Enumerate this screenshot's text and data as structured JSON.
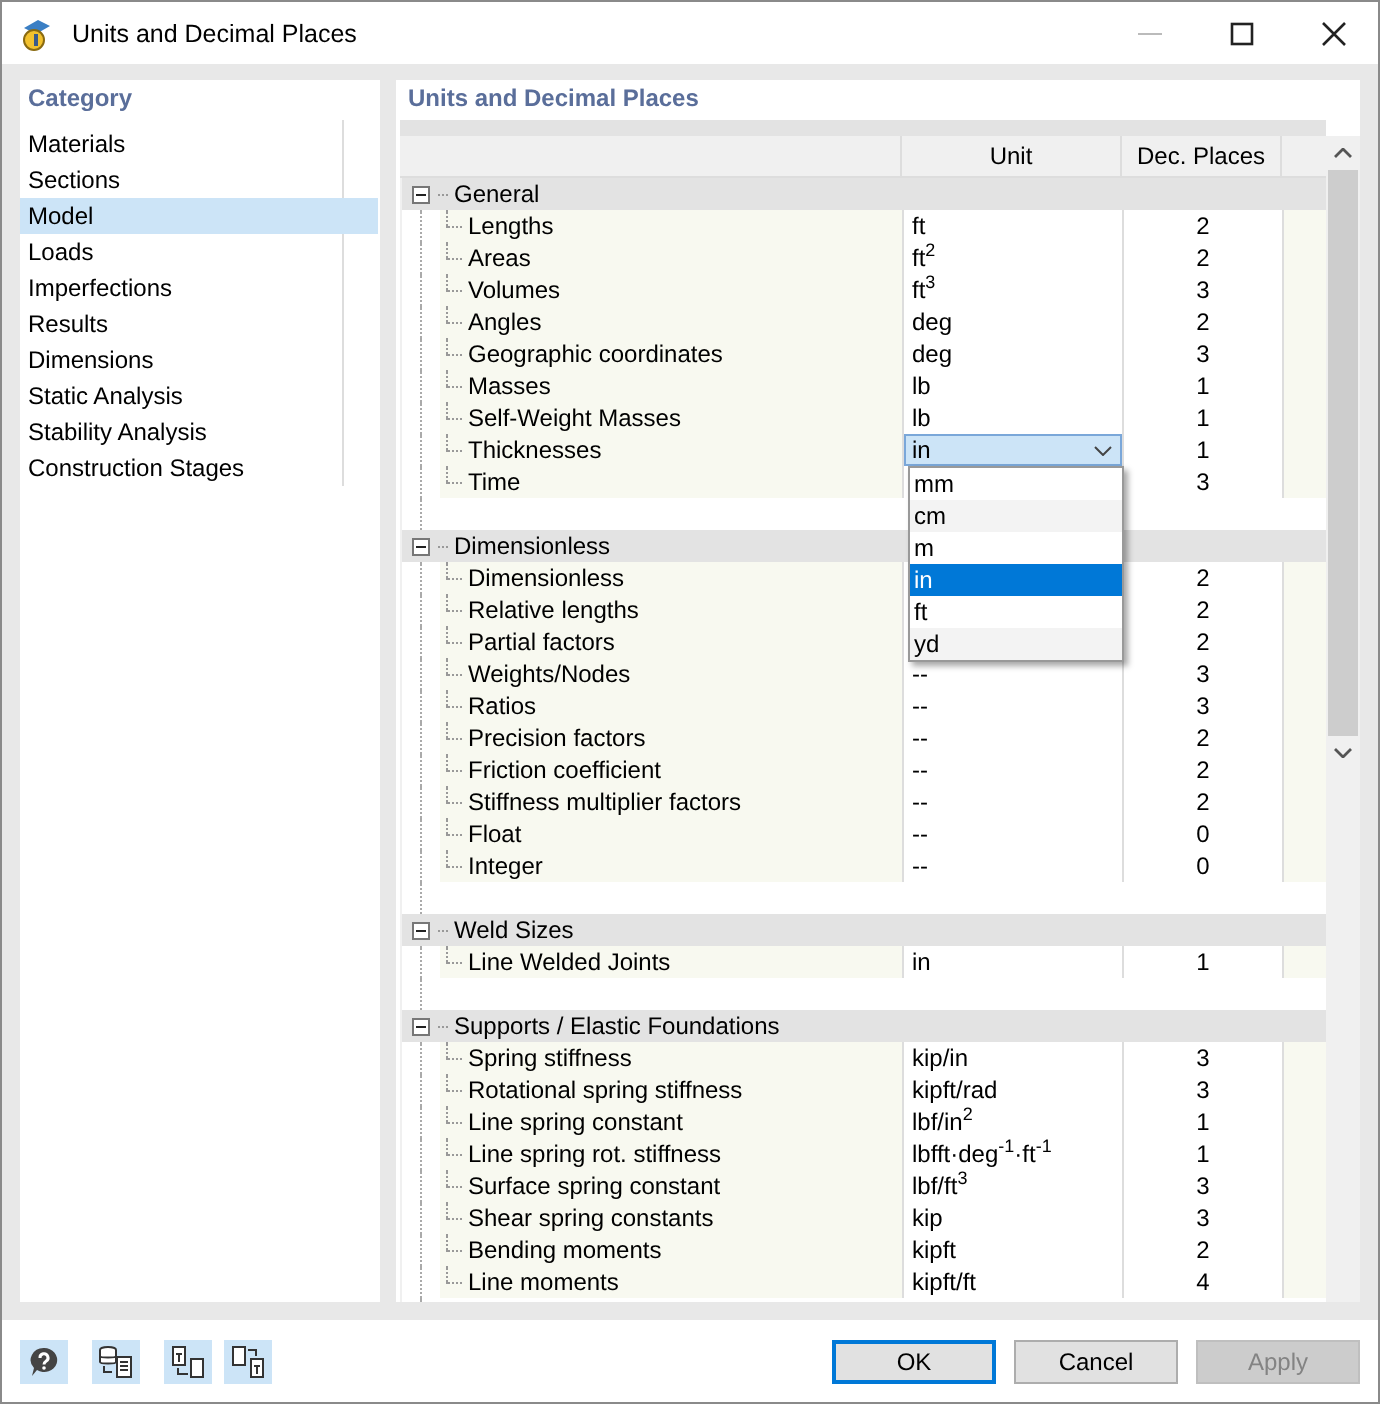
{
  "window": {
    "title": "Units and Decimal Places"
  },
  "sidebar": {
    "title": "Category",
    "items": [
      {
        "label": "Materials",
        "selected": false
      },
      {
        "label": "Sections",
        "selected": false
      },
      {
        "label": "Model",
        "selected": true
      },
      {
        "label": "Loads",
        "selected": false
      },
      {
        "label": "Imperfections",
        "selected": false
      },
      {
        "label": "Results",
        "selected": false
      },
      {
        "label": "Dimensions",
        "selected": false
      },
      {
        "label": "Static Analysis",
        "selected": false
      },
      {
        "label": "Stability Analysis",
        "selected": false
      },
      {
        "label": "Construction Stages",
        "selected": false
      }
    ]
  },
  "table": {
    "title": "Units and Decimal Places",
    "columns": [
      "Unit",
      "Dec. Places"
    ],
    "groups": [
      {
        "label": "General",
        "expanded": true,
        "rows": [
          {
            "name": "Lengths",
            "unit": "ft",
            "decimals": "2"
          },
          {
            "name": "Areas",
            "unit": "ft$^{2}$",
            "decimals": "2"
          },
          {
            "name": "Volumes",
            "unit": "ft$^{3}$",
            "decimals": "3"
          },
          {
            "name": "Angles",
            "unit": "deg",
            "decimals": "2"
          },
          {
            "name": "Geographic coordinates",
            "unit": "deg",
            "decimals": "3"
          },
          {
            "name": "Masses",
            "unit": "lb",
            "decimals": "1"
          },
          {
            "name": "Self-Weight Masses",
            "unit": "lb",
            "decimals": "1"
          },
          {
            "name": "Thicknesses",
            "unit": "in",
            "decimals": "1",
            "dropdown": {
              "options": [
                {
                  "label": "mm",
                  "selected": false
                },
                {
                  "label": "cm",
                  "selected": false
                },
                {
                  "label": "m",
                  "selected": false
                },
                {
                  "label": "in",
                  "selected": true
                },
                {
                  "label": "ft",
                  "selected": false
                },
                {
                  "label": "yd",
                  "selected": false
                }
              ]
            }
          },
          {
            "name": "Time",
            "decimals": "3"
          }
        ]
      },
      {
        "label": "Dimensionless",
        "expanded": true,
        "rows": [
          {
            "name": "Dimensionless",
            "decimals": "2"
          },
          {
            "name": "Relative lengths",
            "decimals": "2"
          },
          {
            "name": "Partial factors",
            "decimals": "2"
          },
          {
            "name": "Weights/Nodes",
            "unit": "--",
            "decimals": "3"
          },
          {
            "name": "Ratios",
            "unit": "--",
            "decimals": "3"
          },
          {
            "name": "Precision factors",
            "unit": "--",
            "decimals": "2"
          },
          {
            "name": "Friction coefficient",
            "unit": "--",
            "decimals": "2"
          },
          {
            "name": "Stiffness multiplier factors",
            "unit": "--",
            "decimals": "2"
          },
          {
            "name": "Float",
            "unit": "--",
            "decimals": "0"
          },
          {
            "name": "Integer",
            "unit": "--",
            "decimals": "0"
          }
        ]
      },
      {
        "label": "Weld Sizes",
        "expanded": true,
        "rows": [
          {
            "name": "Line Welded Joints",
            "unit": "in",
            "decimals": "1"
          }
        ]
      },
      {
        "label": "Supports / Elastic Foundations",
        "expanded": true,
        "rows": [
          {
            "name": "Spring stiffness",
            "unit": "kip/in",
            "decimals": "3"
          },
          {
            "name": "Rotational spring stiffness",
            "unit": "kipft/rad",
            "decimals": "3"
          },
          {
            "name": "Line spring constant",
            "unit": "lbf/in$^{2}$",
            "decimals": "1"
          },
          {
            "name": "Line spring rot. stiffness",
            "unit": "lbfft·deg$^{-1}$·ft$^{-1}$",
            "decimals": "1"
          },
          {
            "name": "Surface spring constant",
            "unit": "lbf/ft$^{3}$",
            "decimals": "3"
          },
          {
            "name": "Shear spring constants",
            "unit": "kip",
            "decimals": "3"
          },
          {
            "name": "Bending moments",
            "unit": "kipft",
            "decimals": "2"
          },
          {
            "name": "Line moments",
            "unit": "kipft/ft",
            "decimals": "4"
          }
        ]
      }
    ]
  },
  "buttons": [
    {
      "label": "OK",
      "kind": "default",
      "disabled": false
    },
    {
      "label": "Cancel",
      "kind": "normal",
      "disabled": false
    },
    {
      "label": "Apply",
      "kind": "normal",
      "disabled": true
    }
  ]
}
